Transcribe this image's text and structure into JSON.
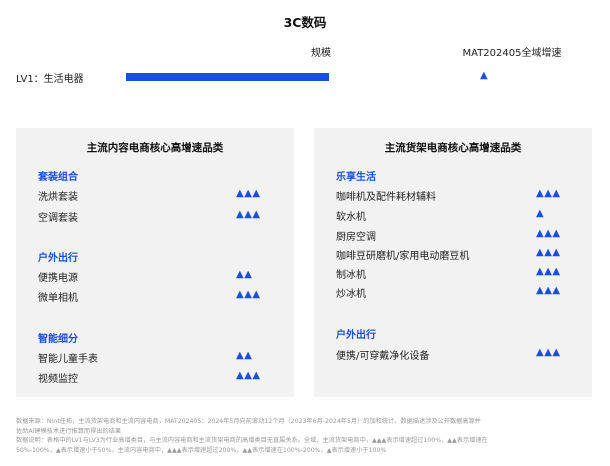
{
  "title": "3C数码",
  "columns": {
    "scale": "规模",
    "growth": "MAT202405全域增速"
  },
  "chart_data": {
    "type": "bar",
    "title": "3C数码",
    "categories": [
      "LV1：生活电器"
    ],
    "series": [
      {
        "name": "规模",
        "values": [
          1
        ]
      }
    ],
    "growth_level": [
      1
    ],
    "growth_symbol": "▲",
    "xlabel": "",
    "ylabel": "",
    "legend": "none",
    "grid": false
  },
  "lv_row": {
    "label": "LV1：生活电器",
    "growth": "▲"
  },
  "colors": {
    "accent": "#1a4fde",
    "panel": "#f2f2f2"
  },
  "panels": [
    {
      "title": "主流内容电商核心高增速品类",
      "groups": [
        {
          "title": "套装组合",
          "items": [
            {
              "label": "洗烘套装",
              "growth": "▲▲▲"
            },
            {
              "label": "空调套装",
              "growth": "▲▲▲"
            }
          ]
        },
        {
          "title": "户外出行",
          "items": [
            {
              "label": "便携电源",
              "growth": "▲▲"
            },
            {
              "label": "微单相机",
              "growth": "▲▲▲"
            }
          ]
        },
        {
          "title": "智能细分",
          "items": [
            {
              "label": "智能儿童手表",
              "growth": "▲▲"
            },
            {
              "label": "视频监控",
              "growth": "▲▲▲"
            }
          ]
        }
      ]
    },
    {
      "title": "主流货架电商核心高增速品类",
      "groups": [
        {
          "title": "乐享生活",
          "items": [
            {
              "label": "咖啡机及配件耗材辅料",
              "growth": "▲▲▲"
            },
            {
              "label": "软水机",
              "growth": "▲"
            },
            {
              "label": "厨房空调",
              "growth": "▲▲▲"
            },
            {
              "label": "咖啡豆研磨机/家用电动磨豆机",
              "growth": "▲▲▲"
            },
            {
              "label": "制冰机",
              "growth": "▲▲▲"
            },
            {
              "label": "炒冰机",
              "growth": "▲▲▲"
            }
          ]
        },
        {
          "title": "户外出行",
          "items": [
            {
              "label": "便携/可穿戴净化设备",
              "growth": "▲▲▲"
            }
          ]
        }
      ]
    }
  ],
  "footer": {
    "line1": "数据来源：Nint任拓，主流货架电商和主流内容电商，MAT202405：2024年5月向前滚动12个月（2023年6月-2024年5月）的加和统计。数据描述涉及公开数据高源并",
    "line2": "佐助AI建模技术进行推算而得出的结果",
    "line3": "数据说明：表格中的LV1与LV3为行业高增类目，与主流内容电商和主流货架电商的高增类目无直属关系。全域、主流货架电商中，▲▲▲表示增速超过100%，▲▲表示增速在",
    "line4": "50%-100%，▲表示增速小于50%，主流内容电商中，▲▲▲表示增速超过200%，▲▲表示增速在100%-200%，▲表示增速小于100%"
  }
}
